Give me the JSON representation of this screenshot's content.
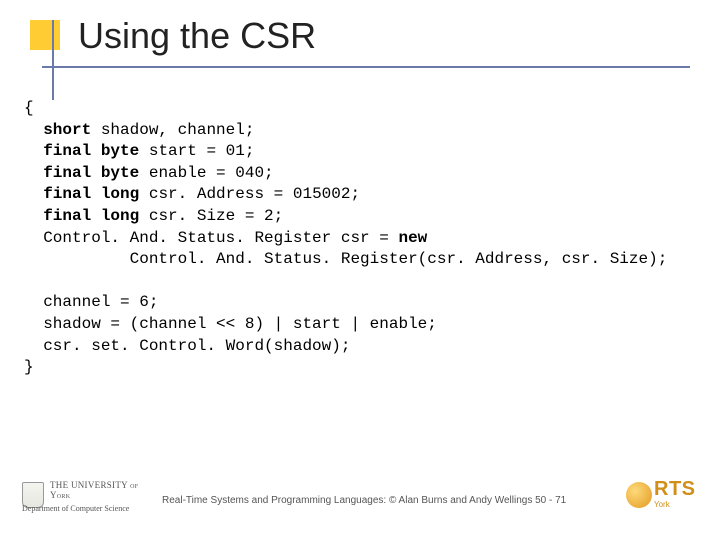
{
  "title": "Using the CSR",
  "code": {
    "kw_short": "short",
    "kw_final": "final",
    "kw_byte": "byte",
    "kw_long": "long",
    "kw_new": "new",
    "l_open": "{",
    "l1_rest": " shadow, channel;",
    "l2_rest": " start = 01;",
    "l3_rest": " enable = 040;",
    "l4_rest": " csr. Address = 015002;",
    "l5_rest": " csr. Size = 2;",
    "l6a": "  Control. And. Status. Register csr = ",
    "l6c": "           Control. And. Status. Register(csr. Address, csr. Size);",
    "l8": "  channel = 6;",
    "l9": "  shadow = (channel << 8) | start | enable;",
    "l10": "  csr. set. Control. Word(shadow);",
    "l_close": "}"
  },
  "footer": {
    "uoy_top": "THE UNIVERSITY of York",
    "uoy_bot": "Department of Computer Science",
    "text": "Real-Time Systems and Programming Languages: © Alan Burns and Andy Wellings 50 - 71",
    "rts": "RTS",
    "rts_sub": "York"
  }
}
